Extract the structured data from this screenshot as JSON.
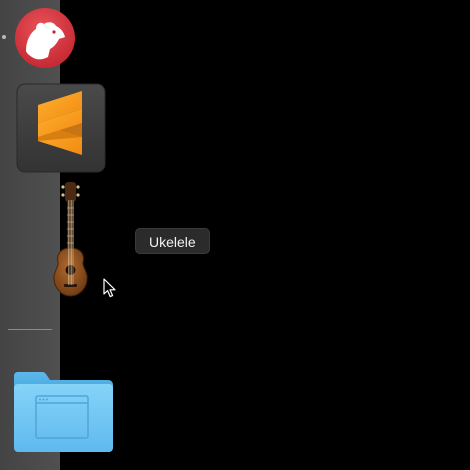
{
  "dock": {
    "running_indicator_app": "bear",
    "apps": [
      {
        "id": "bear",
        "icon": "bear-app-icon",
        "running": true
      },
      {
        "id": "sublime-text",
        "icon": "sublime-text-app-icon",
        "running": false
      },
      {
        "id": "ukelele",
        "icon": "ukelele-app-icon",
        "running": false
      }
    ],
    "folders": [
      {
        "id": "applications-folder",
        "icon": "folder-icon"
      }
    ]
  },
  "tooltip": {
    "text": "Ukelele"
  },
  "colors": {
    "desktop_background": "#000000",
    "dock_background": "#4a4a4a",
    "tooltip_background": "#2b2b2b",
    "tooltip_text": "#f2f2f2",
    "bear_red": "#d8363f",
    "sublime_orange": "#f59c1f",
    "folder_blue": "#6cc8f5"
  }
}
